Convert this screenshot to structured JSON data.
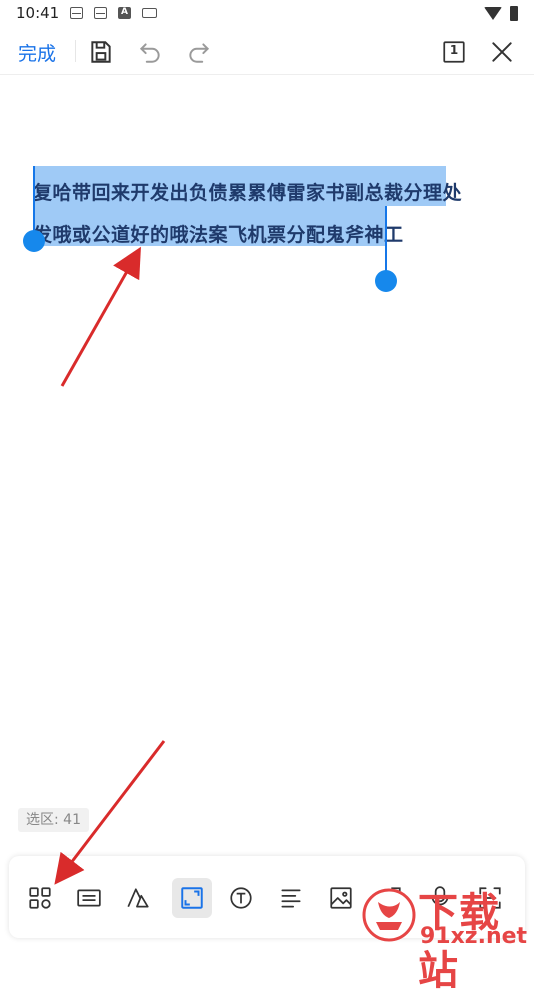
{
  "status_bar": {
    "time": "10:41",
    "icons": [
      "mail-icon",
      "mail-icon",
      "font-icon",
      "keyboard-icon",
      "wifi-icon",
      "battery-icon"
    ]
  },
  "toolbar": {
    "done_label": "完成",
    "page_number": "1",
    "icons": [
      "save-icon",
      "undo-icon",
      "redo-icon",
      "page-count-icon",
      "close-icon"
    ]
  },
  "document": {
    "line1": "复哈带回来开发出负债累累傅雷家书副总裁分理处",
    "line2": "发哦或公道好的哦法案飞机票分配鬼斧神工"
  },
  "selection": {
    "label": "选区: 41"
  },
  "bottom_toolbar": {
    "items": [
      "apps-icon",
      "keyboard-icon",
      "handwriting-icon",
      "select-area-icon",
      "text-icon",
      "align-icon",
      "image-icon",
      "shapes-icon",
      "microphone-icon",
      "scan-icon"
    ],
    "active_index": 3
  },
  "watermark": {
    "title": "下载站",
    "url": "91xz.net"
  },
  "colors": {
    "accent": "#1a73e8",
    "selection": "#9fcaf6",
    "handle": "#1688ec",
    "arrow": "#d92b2b",
    "watermark": "#e64545"
  }
}
